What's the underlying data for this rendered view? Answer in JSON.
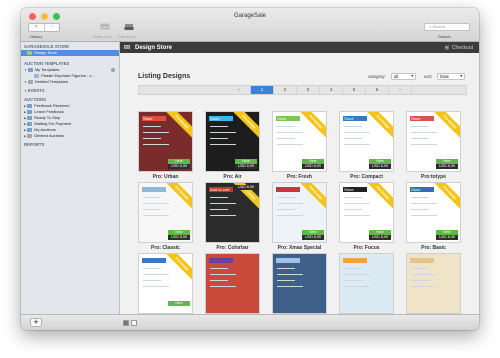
{
  "window": {
    "title": "GarageSale"
  },
  "toolbar": {
    "back_arrow": "‹",
    "forward_arrow": "›",
    "history_label": "History",
    "show_cart_label": "Show Cart",
    "checkout_label": "Checkout",
    "search_placeholder": "Search",
    "search_label": "Search"
  },
  "sidebar": {
    "store_header": "GARAGESALE STORE",
    "store_item": "Design Store",
    "auction_templates_header": "AUCTION TEMPLATES",
    "my_templates": "My Templates",
    "template_item": "Plaster Elephant Figurine - c...",
    "deleted_templates": "Deleted Templates",
    "events_header": "EVENTS",
    "auctions_header": "AUCTIONS",
    "auction_items": [
      "Feedback Received",
      "Leave Feedback",
      "Ready To Ship",
      "Waiting For Payment",
      "My Auctions",
      "Deleted Auctions"
    ],
    "reports_header": "REPORTS",
    "add_button": "+"
  },
  "store_bar": {
    "title": "Design Store",
    "checkout": "Checkout"
  },
  "listing": {
    "heading": "Listing Designs",
    "category_label": "category:",
    "category_value": "all",
    "sort_label": "sort:",
    "sort_value": "Date",
    "pages": [
      "‹",
      "1",
      "2",
      "3",
      "4",
      "5",
      "6",
      "›"
    ],
    "active_page": "1"
  },
  "cards": [
    {
      "label": "Pro: Urban",
      "ribbon": "Pro Design",
      "new": "New",
      "price": "USD 8,99",
      "bg": "#7a2b2b",
      "accent": "#e04f3b",
      "inner_text": "Store"
    },
    {
      "label": "Pro: Air",
      "ribbon": "Pro Design",
      "new": "New",
      "price": "USD 8,99",
      "bg": "#1d1d1d",
      "accent": "#3ab6e8",
      "inner_text": "Store"
    },
    {
      "label": "Pro: Fresh",
      "ribbon": "Pro Design",
      "new": "New",
      "price": "USD 8,99",
      "bg": "#ffffff",
      "accent": "#7cc35a",
      "inner_text": "Store"
    },
    {
      "label": "Pro: Compact",
      "ribbon": "Pro Design",
      "new": "New",
      "price": "USD 8,99",
      "bg": "#ffffff",
      "accent": "#3a78c2",
      "inner_text": "Store"
    },
    {
      "label": "Pro:totype",
      "ribbon": "Pro Design",
      "new": "New",
      "price": "USD 8,99",
      "bg": "#ffffff",
      "accent": "#d9534f",
      "inner_text": "Store"
    },
    {
      "label": "Pro: Classic",
      "ribbon": "Pro Design",
      "new": "New",
      "price": "USD 8,99",
      "bg": "#f7f7f7",
      "accent": "#8fb8d9",
      "inner_text": ""
    },
    {
      "label": "Pro: Colorbar",
      "ribbon": "Pro Design",
      "new": "",
      "price": "USD 8,99",
      "bg": "#2b2b2b",
      "accent": "#c0392b",
      "inner_text": "Add to cart"
    },
    {
      "label": "Pro: Xmas Special",
      "ribbon": "Pro Design",
      "new": "New",
      "price": "USD 8,99",
      "bg": "#eef3f7",
      "accent": "#c23b3b",
      "inner_text": ""
    },
    {
      "label": "Pro: Focus",
      "ribbon": "Pro Design",
      "new": "New",
      "price": "USD 8,99",
      "bg": "#ffffff",
      "accent": "#222222",
      "inner_text": "Store"
    },
    {
      "label": "Pro: Basic",
      "ribbon": "Pro Design",
      "new": "New",
      "price": "USD 8,99",
      "bg": "#ffffff",
      "accent": "#2f6fb6",
      "inner_text": "Store"
    },
    {
      "label": "",
      "ribbon": "Pro Design",
      "new": "New",
      "price": "",
      "bg": "#ffffff",
      "accent": "#3a78c2",
      "inner_text": ""
    },
    {
      "label": "",
      "ribbon": "",
      "new": "",
      "price": "",
      "bg": "#c94a3a",
      "accent": "#6a3fa0",
      "inner_text": ""
    },
    {
      "label": "",
      "ribbon": "",
      "new": "",
      "price": "",
      "bg": "#3d5f8a",
      "accent": "#9ec3e6",
      "inner_text": ""
    },
    {
      "label": "",
      "ribbon": "",
      "new": "",
      "price": "",
      "bg": "#dceaf3",
      "accent": "#f0a23b",
      "inner_text": ""
    },
    {
      "label": "",
      "ribbon": "",
      "new": "",
      "price": "",
      "bg": "#efe3c8",
      "accent": "#e7c48a",
      "inner_text": ""
    }
  ],
  "colors": {
    "accent": "#3a84d8",
    "ribbon": "#f3c419",
    "new": "#5fb847"
  }
}
